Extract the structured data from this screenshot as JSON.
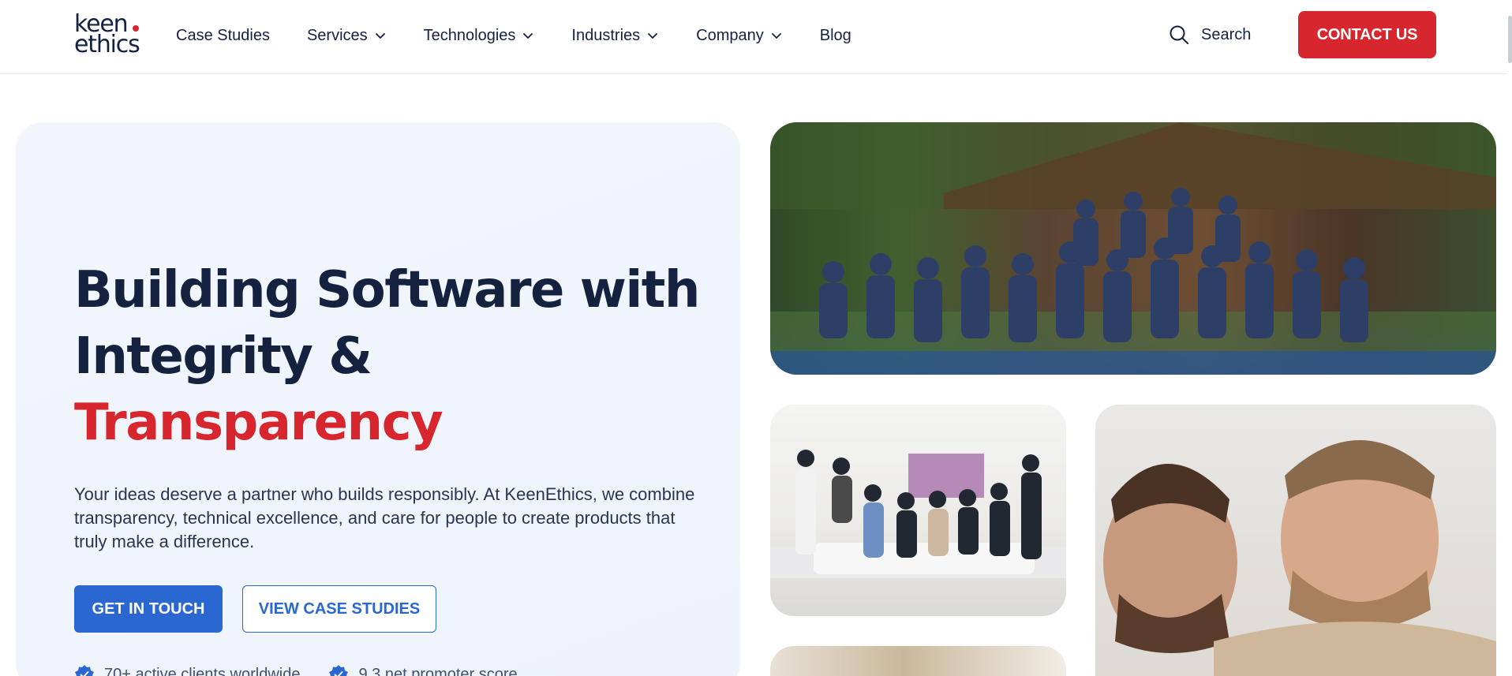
{
  "brand": {
    "logo_line1": "keen",
    "logo_line2": "ethics",
    "accent": "#d7262e",
    "primary": "#2b67d1",
    "navy": "#142240"
  },
  "nav": {
    "items": [
      {
        "label": "Case Studies",
        "dropdown": false
      },
      {
        "label": "Services",
        "dropdown": true
      },
      {
        "label": "Technologies",
        "dropdown": true
      },
      {
        "label": "Industries",
        "dropdown": true
      },
      {
        "label": "Company",
        "dropdown": true
      },
      {
        "label": "Blog",
        "dropdown": false
      }
    ],
    "search_label": "Search",
    "contact_label": "CONTACT US"
  },
  "hero": {
    "title_line1": "Building Software with",
    "title_line2": "Integrity &",
    "title_line3": "Transparency",
    "description": "Your ideas deserve a partner who builds responsibly. At KeenEthics, we combine transparency, technical excellence, and care for people to create products that truly make a difference.",
    "primary_cta": "GET IN TOUCH",
    "secondary_cta": "VIEW CASE STUDIES",
    "stats": [
      {
        "label": "70+ active clients worldwide"
      },
      {
        "label": "9.3 net promoter score"
      }
    ]
  },
  "photos": {
    "team": "team-photo",
    "office": "office-photo",
    "developers": "developers-photo",
    "workspace": "workspace-photo"
  }
}
